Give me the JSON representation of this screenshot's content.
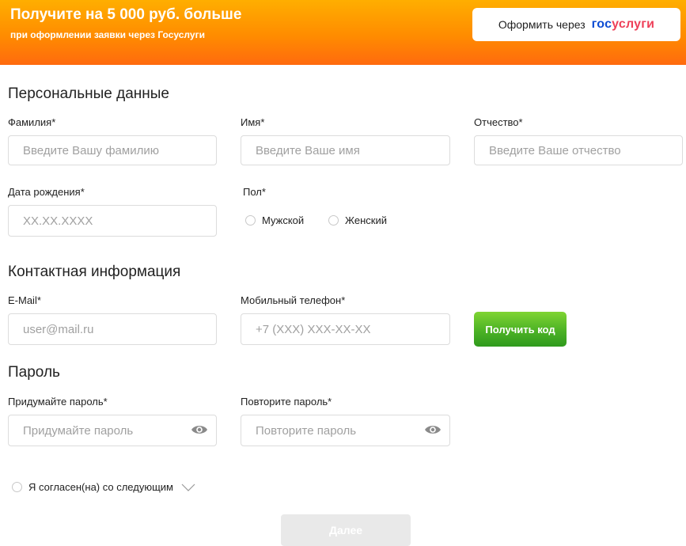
{
  "banner": {
    "title": "Получите на 5 000 руб. больше",
    "subtitle": "при оформлении заявки через Госуслуги",
    "gosuslugi_button": {
      "text": "Оформить через",
      "logo_part1": "гос",
      "logo_part2": "услуги"
    }
  },
  "personal": {
    "heading": "Персональные данные",
    "lastname": {
      "label": "Фамилия*",
      "placeholder": "Введите Вашу фамилию"
    },
    "firstname": {
      "label": "Имя*",
      "placeholder": "Введите Ваше имя"
    },
    "patronymic": {
      "label": "Отчество*",
      "placeholder": "Введите Ваше отчество"
    },
    "birthdate": {
      "label": "Дата рождения*",
      "placeholder": "XX.XX.XXXX"
    },
    "gender": {
      "label": "Пол*",
      "options": [
        "Мужской",
        "Женский"
      ]
    }
  },
  "contacts": {
    "heading": "Контактная информация",
    "email": {
      "label": "E-Mail*",
      "placeholder": "user@mail.ru"
    },
    "phone": {
      "label": "Мобильный телефон*",
      "placeholder": "+7 (XXX) XXX-XX-XX"
    },
    "get_code_label": "Получить код"
  },
  "password": {
    "heading": "Пароль",
    "create": {
      "label": "Придумайте пароль*",
      "placeholder": "Придумайте пароль"
    },
    "repeat": {
      "label": "Повторите пароль*",
      "placeholder": "Повторите пароль"
    }
  },
  "agreement": {
    "label": "Я согласен(на) со следующим"
  },
  "next_button_label": "Далее",
  "colors": {
    "banner_top": "#ffae00",
    "banner_bottom": "#ff6a0e",
    "gos_blue": "#0d4cd3",
    "gos_red": "#ee3f58",
    "button_green": "#4cb225",
    "button_disabled": "#e9e9e9"
  },
  "icons": {
    "password_toggle": "eye-icon",
    "agreement_expand": "chevron-down-icon"
  }
}
